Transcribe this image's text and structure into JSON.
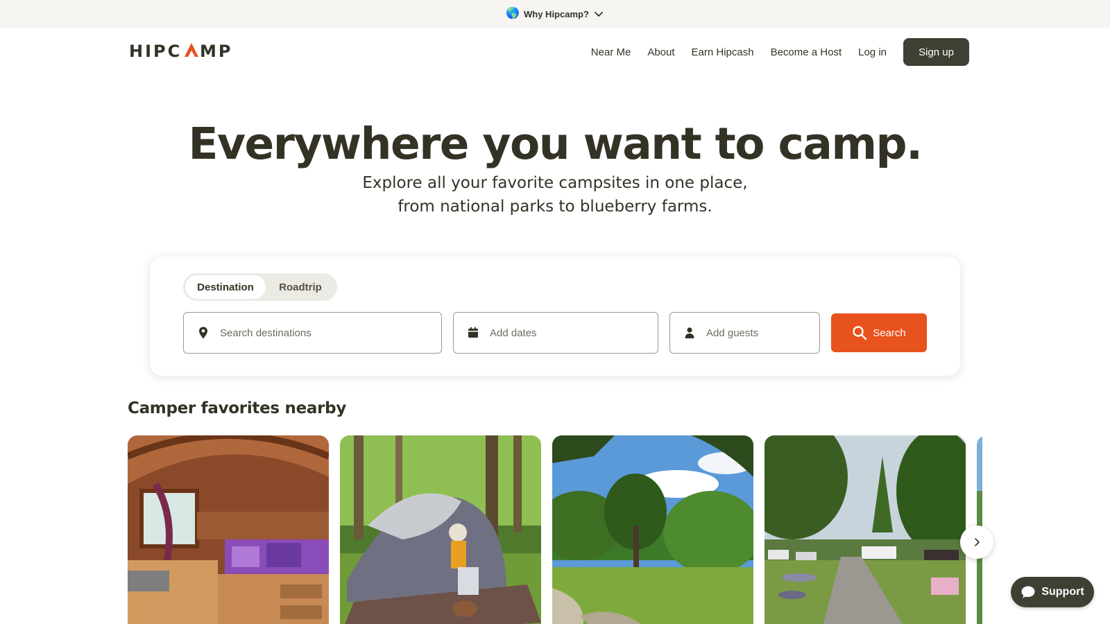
{
  "banner": {
    "icon": "globe-icon",
    "text": "Why Hipcamp?"
  },
  "header": {
    "logo_text": "HIPCAMP",
    "nav": [
      {
        "label": "Near Me"
      },
      {
        "label": "About"
      },
      {
        "label": "Earn Hipcash"
      },
      {
        "label": "Become a Host"
      },
      {
        "label": "Log in"
      }
    ],
    "signup_label": "Sign up"
  },
  "hero": {
    "title": "Everywhere you want to camp.",
    "subtitle_line1": "Explore all your favorite campsites in one place,",
    "subtitle_line2": "from national parks to blueberry farms."
  },
  "search": {
    "tabs": [
      {
        "label": "Destination",
        "active": true
      },
      {
        "label": "Roadtrip",
        "active": false
      }
    ],
    "destination_placeholder": "Search destinations",
    "dates_placeholder": "Add dates",
    "guests_placeholder": "Add guests",
    "button_label": "Search"
  },
  "favorites": {
    "title": "Camper favorites nearby",
    "cards": [
      {
        "image": "cabin interior with purple quilt bed"
      },
      {
        "image": "tent in forest with woman and dog"
      },
      {
        "image": "grassy field with trees and blue sky"
      },
      {
        "image": "gravel road campground with cars"
      },
      {
        "image": "partial card"
      }
    ]
  },
  "support": {
    "label": "Support"
  },
  "colors": {
    "brand_orange": "#e8521d",
    "dark_green": "#3d4033",
    "text": "#333225",
    "banner_bg": "#f6f5f2"
  }
}
